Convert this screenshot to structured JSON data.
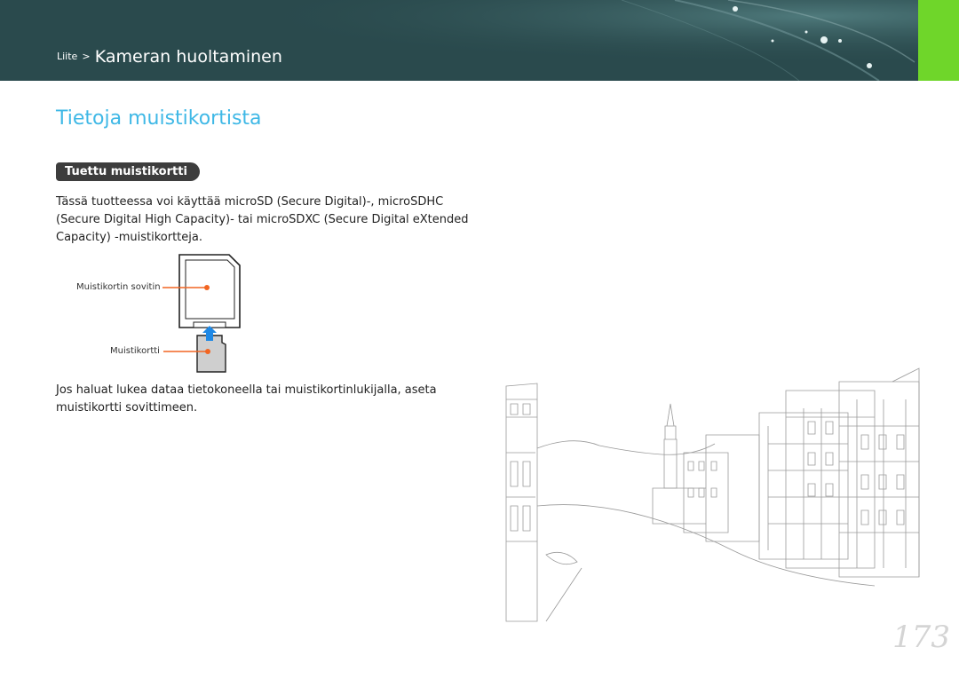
{
  "header": {
    "breadcrumb_parent": "Liite",
    "breadcrumb_separator": ">",
    "breadcrumb_current": "Kameran huoltaminen",
    "background_color": "#2a4a4d",
    "accent_tab_color": "#6fd62a"
  },
  "page": {
    "title": "Tietoja muistikortista",
    "section_heading": "Tuettu muistikortti",
    "paragraph_1": "Tässä tuotteessa voi käyttää microSD (Secure Digital)-, microSDHC (Secure Digital High Capacity)- tai microSDXC (Secure Digital eXtended Capacity) -muistikortteja.",
    "paragraph_2": "Jos haluat lukea dataa tietokoneella tai muistikortinlukijalla, aseta muistikortti sovittimeen.",
    "page_number": "173"
  },
  "figure": {
    "adapter_label": "Muistikortin sovitin",
    "card_label": "Muistikortti",
    "callout_color": "#f26522",
    "arrow_color": "#1e88e5"
  },
  "colors": {
    "title": "#3fb8e6",
    "heading_pill": "#3d3d3d"
  }
}
